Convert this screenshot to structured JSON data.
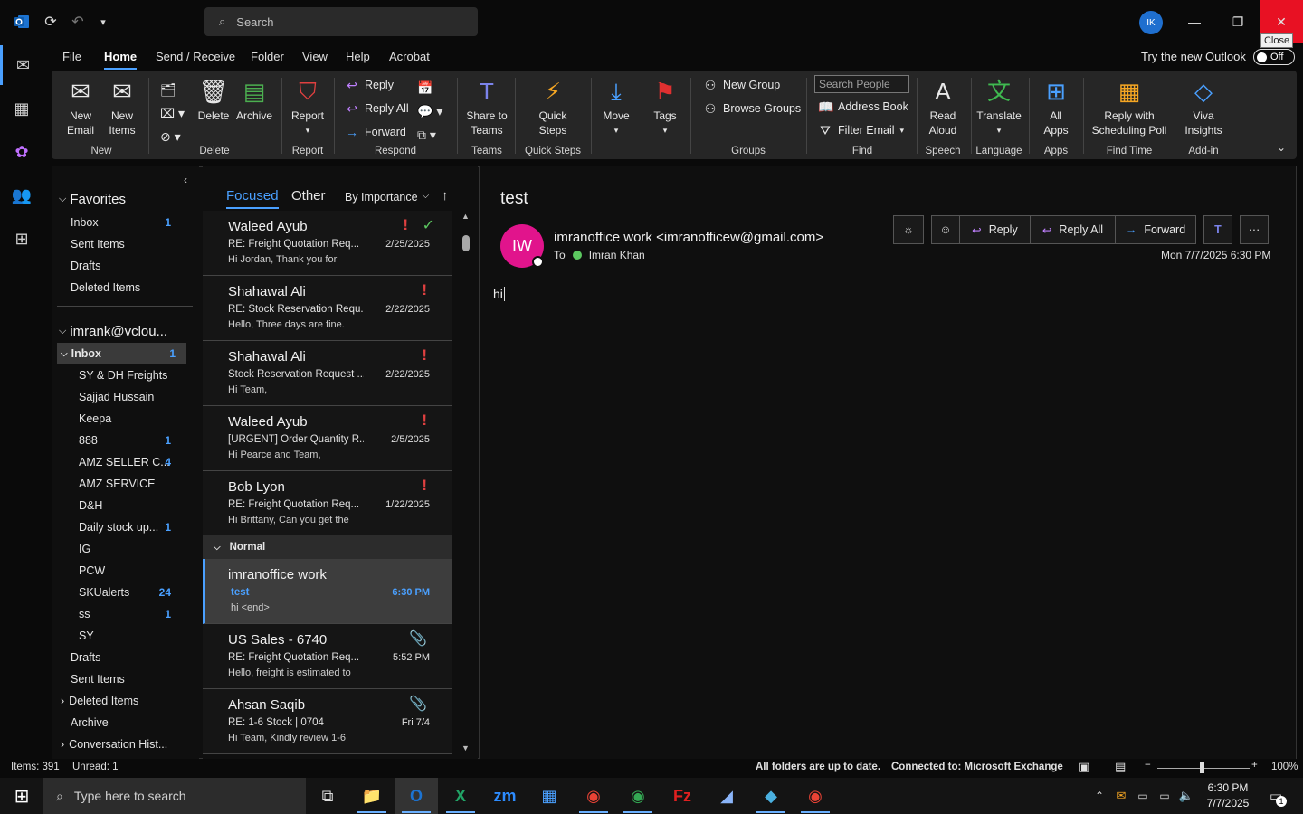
{
  "titlebar": {
    "search_placeholder": "Search",
    "avatar_initials": "IK",
    "close_tooltip": "Close"
  },
  "menu": {
    "tabs": [
      "File",
      "Home",
      "Send / Receive",
      "Folder",
      "View",
      "Help",
      "Acrobat"
    ],
    "active": "Home",
    "try_new": "Try the new Outlook",
    "toggle_label": "Off"
  },
  "ribbon": {
    "new_email": "New\nEmail",
    "new_items": "New\nItems",
    "delete": "Delete",
    "archive": "Archive",
    "report": "Report",
    "reply": "Reply",
    "reply_all": "Reply All",
    "forward": "Forward",
    "share_teams": "Share to\nTeams",
    "quick_steps": "Quick\nSteps",
    "move": "Move",
    "tags": "Tags",
    "new_group": "New Group",
    "browse_groups": "Browse Groups",
    "search_people": "Search People",
    "address_book": "Address Book",
    "filter_email": "Filter Email",
    "read_aloud": "Read\nAloud",
    "translate": "Translate",
    "all_apps": "All\nApps",
    "scheduling_poll": "Reply with\nScheduling Poll",
    "viva_insights": "Viva\nInsights",
    "groups": {
      "new": "New",
      "delete": "Delete",
      "report": "Report",
      "respond": "Respond",
      "teams": "Teams",
      "quick_steps": "Quick Steps",
      "groups": "Groups",
      "find": "Find",
      "speech": "Speech",
      "language": "Language",
      "apps": "Apps",
      "find_time": "Find Time",
      "addin": "Add-in"
    }
  },
  "folders": {
    "favorites_title": "Favorites",
    "favorites": [
      {
        "name": "Inbox",
        "count": "1"
      },
      {
        "name": "Sent Items",
        "count": ""
      },
      {
        "name": "Drafts",
        "count": ""
      },
      {
        "name": "Deleted Items",
        "count": ""
      }
    ],
    "account": "imrank@vclou...",
    "inbox": {
      "name": "Inbox",
      "count": "1"
    },
    "subfolders": [
      {
        "name": "SY & DH Freights",
        "count": ""
      },
      {
        "name": "Sajjad Hussain",
        "count": ""
      },
      {
        "name": "Keepa",
        "count": ""
      },
      {
        "name": "888",
        "count": "1"
      },
      {
        "name": "AMZ SELLER C...",
        "count": "4"
      },
      {
        "name": "AMZ SERVICE",
        "count": ""
      },
      {
        "name": "D&H",
        "count": ""
      },
      {
        "name": "Daily stock up...",
        "count": "1"
      },
      {
        "name": "IG",
        "count": ""
      },
      {
        "name": "PCW",
        "count": ""
      },
      {
        "name": "SKUalerts",
        "count": "24"
      },
      {
        "name": "ss",
        "count": "1"
      },
      {
        "name": "SY",
        "count": ""
      }
    ],
    "others": [
      {
        "name": "Drafts"
      },
      {
        "name": "Sent Items"
      },
      {
        "name": "Deleted Items"
      },
      {
        "name": "Archive"
      },
      {
        "name": "Conversation Hist..."
      }
    ]
  },
  "list": {
    "tab_focused": "Focused",
    "tab_other": "Other",
    "sort": "By Importance",
    "normal_header": "Normal",
    "messages": [
      {
        "sender": "Waleed Ayub",
        "subject": "RE: Freight Quotation Req...",
        "preview": "Hi Jordan,  Thank you for",
        "date": "2/25/2025",
        "flag": "!",
        "check": "✓"
      },
      {
        "sender": "Shahawal Ali",
        "subject": "RE: Stock Reservation Requ...",
        "preview": "Hello,  Three days are fine.",
        "date": "2/22/2025",
        "flag": "!"
      },
      {
        "sender": "Shahawal Ali",
        "subject": "Stock Reservation Request ...",
        "preview": "Hi Team,",
        "date": "2/22/2025",
        "flag": "!"
      },
      {
        "sender": "Waleed Ayub",
        "subject": "[URGENT] Order Quantity R...",
        "preview": "Hi Pearce and Team,",
        "date": "2/5/2025",
        "flag": "!"
      },
      {
        "sender": "Bob Lyon",
        "subject": "RE: Freight Quotation Req...",
        "preview": "Hi Brittany,  Can you get the",
        "date": "1/22/2025",
        "flag": "!"
      }
    ],
    "normal_messages": [
      {
        "sender": "imranoffice work",
        "subject": "test",
        "preview": "hi <end>",
        "date": "6:30 PM"
      },
      {
        "sender": "US Sales - 6740",
        "subject": "RE: Freight Quotation Req...",
        "preview": "Hello, freight is estimated to",
        "date": "5:52 PM",
        "clip": "📎"
      },
      {
        "sender": "Ahsan Saqib",
        "subject": "RE: 1-6 Stock | 0704",
        "preview": "Hi Team,  Kindly review 1-6",
        "date": "Fri 7/4",
        "clip": "📎"
      }
    ]
  },
  "reading": {
    "subject": "test",
    "avatar": "IW",
    "from": "imranoffice work <imranofficew@gmail.com>",
    "to_label": "To",
    "to": "Imran Khan",
    "date": "Mon 7/7/2025 6:30 PM",
    "body": "hi",
    "reply": "Reply",
    "reply_all": "Reply All",
    "forward": "Forward"
  },
  "status": {
    "items": "Items: 391",
    "unread": "Unread: 1",
    "sync": "All folders are up to date.",
    "connection": "Connected to: Microsoft Exchange",
    "zoom": "100%"
  },
  "taskbar": {
    "search_placeholder": "Type here to search",
    "time": "6:30 PM",
    "date": "7/7/2025",
    "notif_count": "1"
  }
}
